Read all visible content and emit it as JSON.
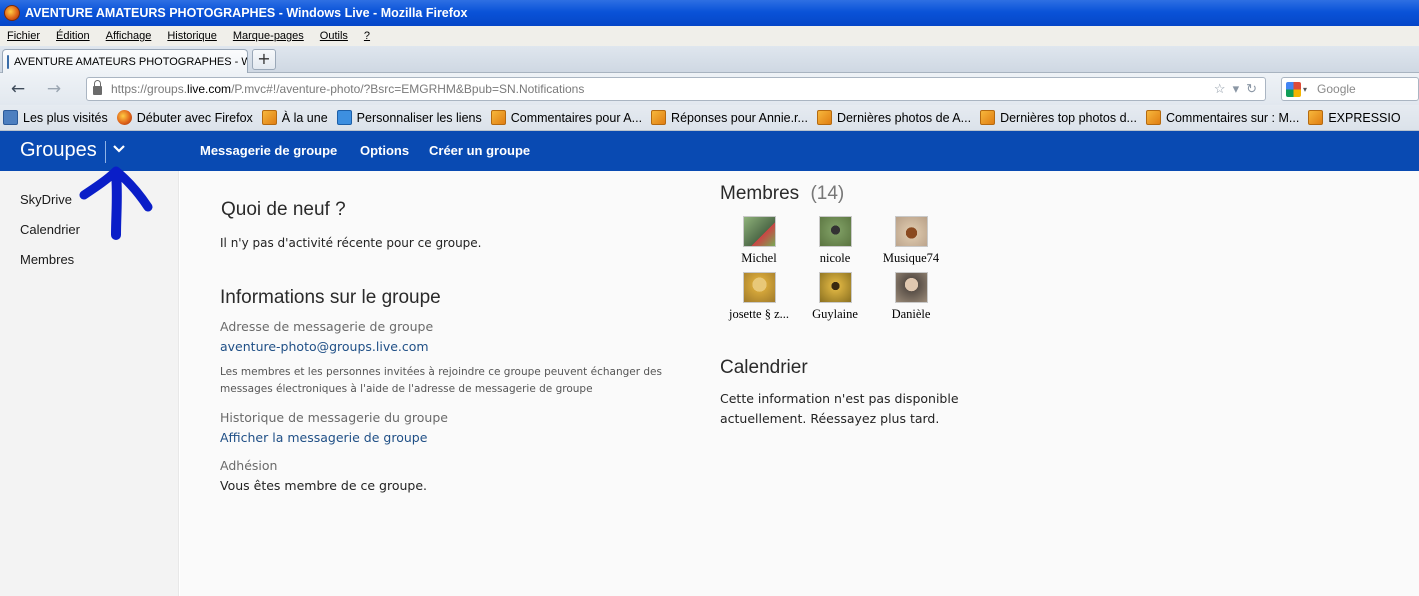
{
  "window": {
    "title": "AVENTURE AMATEURS PHOTOGRAPHES - Windows Live - Mozilla Firefox"
  },
  "menu": [
    "Fichier",
    "Édition",
    "Affichage",
    "Historique",
    "Marque-pages",
    "Outils",
    "?"
  ],
  "tab": {
    "title": "AVENTURE AMATEURS PHOTOGRAPHES - W...",
    "close": "×",
    "new_tab": "+"
  },
  "nav": {
    "back": "←",
    "forward": "→",
    "url_prefix": "https://groups.",
    "url_domain": "live.com",
    "url_path": "/P.mvc#!/aventure-photo/?Bsrc=EMGRHM&Bpub=SN.Notifications",
    "star": "☆",
    "dropdown": "▾",
    "reload": "↻",
    "search_placeholder": "Google"
  },
  "bookmarks": [
    {
      "label": "Les plus visités",
      "icon": "search"
    },
    {
      "label": "Débuter avec Firefox",
      "icon": "firefox"
    },
    {
      "label": "À la une",
      "icon": "rss"
    },
    {
      "label": "Personnaliser les liens",
      "icon": "ie"
    },
    {
      "label": "Commentaires pour A...",
      "icon": "rss"
    },
    {
      "label": "Réponses pour Annie.r...",
      "icon": "rss"
    },
    {
      "label": "Dernières photos de A...",
      "icon": "rss"
    },
    {
      "label": "Dernières top photos d...",
      "icon": "rss"
    },
    {
      "label": "Commentaires sur : M...",
      "icon": "rss"
    },
    {
      "label": "EXPRESSIO",
      "icon": "rss"
    }
  ],
  "topnav": {
    "brand": "Groupes",
    "links": [
      "Messagerie de groupe",
      "Options",
      "Créer un groupe"
    ]
  },
  "sidebar": {
    "items": [
      "SkyDrive",
      "Calendrier",
      "Membres"
    ]
  },
  "main": {
    "news_title": "Quoi de neuf ?",
    "news_text": "Il n'y pas d'activité récente pour ce groupe.",
    "info_title": "Informations sur le groupe",
    "email_label": "Adresse de messagerie de groupe",
    "email_value": "aventure-photo@groups.live.com",
    "email_note": "Les membres et les personnes invitées à rejoindre ce groupe peuvent échanger des messages électroniques à l'aide de l'adresse de messagerie de groupe",
    "history_label": "Historique de messagerie du groupe",
    "history_link": "Afficher la messagerie de groupe",
    "membership_label": "Adhésion",
    "membership_value": "Vous êtes membre de ce groupe."
  },
  "members_panel": {
    "title": "Membres",
    "count": "(14)",
    "members": [
      {
        "name": "Michel",
        "color": "#7a9a6a"
      },
      {
        "name": "nicole",
        "color": "#6f8a5a"
      },
      {
        "name": "Musique74",
        "color": "#c9a98a"
      },
      {
        "name": "josette § z...",
        "color": "#d8b050"
      },
      {
        "name": "Guylaine",
        "color": "#b89a3a"
      },
      {
        "name": "Danièle",
        "color": "#8a7a6a"
      }
    ]
  },
  "calendar_panel": {
    "title": "Calendrier",
    "line1": "Cette information n'est pas disponible",
    "line2": "actuellement. Réessayez plus tard."
  },
  "colors": {
    "topnav_bg": "#094ab2",
    "link": "#1f4f86",
    "annotation": "#0a1ec8"
  }
}
